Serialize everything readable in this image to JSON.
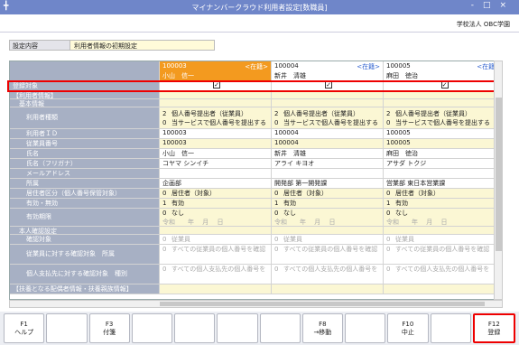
{
  "window": {
    "title": "マイナンバークラウド利用者設定[数職員]",
    "company": "学校法人 OBC学園"
  },
  "setting": {
    "label": "設定内容",
    "value": "利用者情報の初期設定"
  },
  "employees": [
    {
      "code": "100003",
      "status": "<在籍>",
      "name": "小山　信一",
      "selected": true
    },
    {
      "code": "100004",
      "status": "<在籍>",
      "name": "新井　清雄",
      "selected": false
    },
    {
      "code": "100005",
      "status": "<在籍>",
      "name": "麻田　徳治",
      "selected": false
    }
  ],
  "rows": {
    "target": {
      "label": "登録対象"
    },
    "user_info": {
      "label": "【利用者情報】"
    },
    "basic": {
      "label": "基本情報"
    },
    "user_type": {
      "label": "利用者種類",
      "line1": {
        "num": "2",
        "text": "個人番号提出者（従業員）"
      },
      "line2": {
        "num": "0",
        "text": "当サービスで個人番号を提出する"
      }
    },
    "user_id": {
      "label": "利用者ＩＤ",
      "values": [
        "100003",
        "100004",
        "100005"
      ]
    },
    "emp_no": {
      "label": "従業員番号",
      "values": [
        "100003",
        "100004",
        "100005"
      ]
    },
    "name": {
      "label": "氏名",
      "values": [
        "小山　信一",
        "新井　清雄",
        "麻田　徳治"
      ]
    },
    "kana": {
      "label": "氏名（フリガナ）",
      "values": [
        "コヤマ シンイチ",
        "アライ キヨオ",
        "アサダ トクジ"
      ]
    },
    "email": {
      "label": "メールアドレス"
    },
    "dept": {
      "label": "所属",
      "values": [
        "企画部",
        "開発部 第一開発課",
        "営業部 東日本営業課"
      ]
    },
    "residence": {
      "label": "居住者区分（個人番号保管対象）",
      "num": "0",
      "text": "居住者（対象）"
    },
    "valid": {
      "label": "有効・無効",
      "num": "1",
      "text": "有効"
    },
    "period": {
      "label": "有効期限",
      "num": "0",
      "text": "なし",
      "date": "令和　　年　 月　 日"
    },
    "identity": {
      "label": "本人確認設定"
    },
    "confirm_target": {
      "label": "確認対象",
      "num": "0",
      "text": "従業員"
    },
    "emp_confirm": {
      "label": "従業員に対する確認対象　所属",
      "num": "0",
      "text": "すべての従業員の個人番号を確認"
    },
    "pay_confirm": {
      "label": "個人支払先に対する確認対象　種別",
      "num": "0",
      "text": "すべての個人支払先の個人番号を"
    },
    "dependents": {
      "label": "【扶養となる配偶者情報・扶養親族情報】"
    }
  },
  "function_keys": [
    {
      "key": "F1",
      "label": "ヘルプ",
      "active": false
    },
    {
      "key": "",
      "label": "",
      "active": false
    },
    {
      "key": "F3",
      "label": "付箋",
      "active": false
    },
    {
      "key": "",
      "label": "",
      "active": false
    },
    {
      "key": "",
      "label": "",
      "active": false
    },
    {
      "key": "",
      "label": "",
      "active": false
    },
    {
      "key": "",
      "label": "",
      "active": false
    },
    {
      "key": "F8",
      "label": "→移動",
      "active": false
    },
    {
      "key": "",
      "label": "",
      "active": false
    },
    {
      "key": "F10",
      "label": "中止",
      "active": false
    },
    {
      "key": "",
      "label": "",
      "active": false
    },
    {
      "key": "F12",
      "label": "登録",
      "active": true
    }
  ],
  "colors": {
    "titlebar": "#6f86c9",
    "selected_employee": "#f39a1f",
    "highlight": "#e00000",
    "label_column": "#a7b0c4"
  },
  "icons": {
    "app": "plus-icon",
    "check": "check-icon"
  }
}
